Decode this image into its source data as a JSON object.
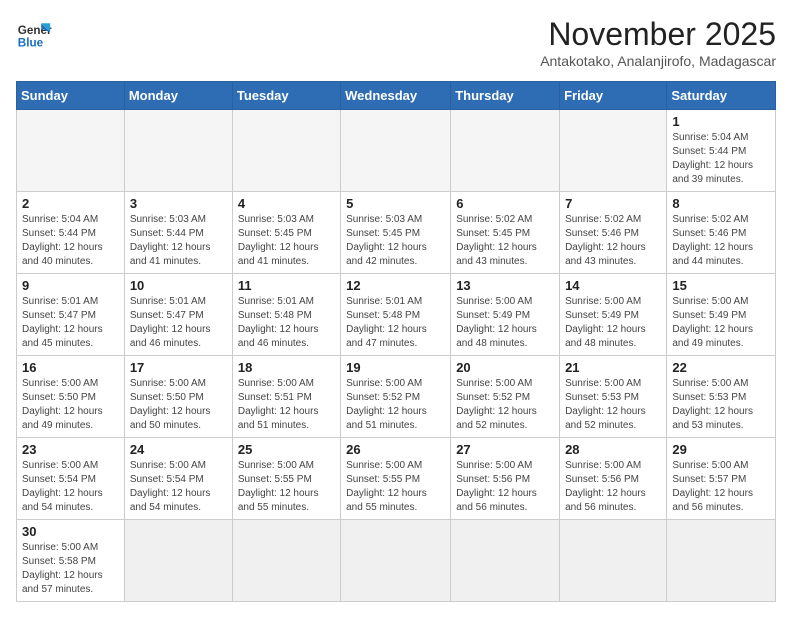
{
  "logo": {
    "text_general": "General",
    "text_blue": "Blue"
  },
  "title": "November 2025",
  "subtitle": "Antakotako, Analanjirofo, Madagascar",
  "days_header": [
    "Sunday",
    "Monday",
    "Tuesday",
    "Wednesday",
    "Thursday",
    "Friday",
    "Saturday"
  ],
  "weeks": [
    [
      {
        "day": "",
        "info": ""
      },
      {
        "day": "",
        "info": ""
      },
      {
        "day": "",
        "info": ""
      },
      {
        "day": "",
        "info": ""
      },
      {
        "day": "",
        "info": ""
      },
      {
        "day": "",
        "info": ""
      },
      {
        "day": "1",
        "info": "Sunrise: 5:04 AM\nSunset: 5:44 PM\nDaylight: 12 hours\nand 39 minutes."
      }
    ],
    [
      {
        "day": "2",
        "info": "Sunrise: 5:04 AM\nSunset: 5:44 PM\nDaylight: 12 hours\nand 40 minutes."
      },
      {
        "day": "3",
        "info": "Sunrise: 5:03 AM\nSunset: 5:44 PM\nDaylight: 12 hours\nand 41 minutes."
      },
      {
        "day": "4",
        "info": "Sunrise: 5:03 AM\nSunset: 5:45 PM\nDaylight: 12 hours\nand 41 minutes."
      },
      {
        "day": "5",
        "info": "Sunrise: 5:03 AM\nSunset: 5:45 PM\nDaylight: 12 hours\nand 42 minutes."
      },
      {
        "day": "6",
        "info": "Sunrise: 5:02 AM\nSunset: 5:45 PM\nDaylight: 12 hours\nand 43 minutes."
      },
      {
        "day": "7",
        "info": "Sunrise: 5:02 AM\nSunset: 5:46 PM\nDaylight: 12 hours\nand 43 minutes."
      },
      {
        "day": "8",
        "info": "Sunrise: 5:02 AM\nSunset: 5:46 PM\nDaylight: 12 hours\nand 44 minutes."
      }
    ],
    [
      {
        "day": "9",
        "info": "Sunrise: 5:01 AM\nSunset: 5:47 PM\nDaylight: 12 hours\nand 45 minutes."
      },
      {
        "day": "10",
        "info": "Sunrise: 5:01 AM\nSunset: 5:47 PM\nDaylight: 12 hours\nand 46 minutes."
      },
      {
        "day": "11",
        "info": "Sunrise: 5:01 AM\nSunset: 5:48 PM\nDaylight: 12 hours\nand 46 minutes."
      },
      {
        "day": "12",
        "info": "Sunrise: 5:01 AM\nSunset: 5:48 PM\nDaylight: 12 hours\nand 47 minutes."
      },
      {
        "day": "13",
        "info": "Sunrise: 5:00 AM\nSunset: 5:49 PM\nDaylight: 12 hours\nand 48 minutes."
      },
      {
        "day": "14",
        "info": "Sunrise: 5:00 AM\nSunset: 5:49 PM\nDaylight: 12 hours\nand 48 minutes."
      },
      {
        "day": "15",
        "info": "Sunrise: 5:00 AM\nSunset: 5:49 PM\nDaylight: 12 hours\nand 49 minutes."
      }
    ],
    [
      {
        "day": "16",
        "info": "Sunrise: 5:00 AM\nSunset: 5:50 PM\nDaylight: 12 hours\nand 49 minutes."
      },
      {
        "day": "17",
        "info": "Sunrise: 5:00 AM\nSunset: 5:50 PM\nDaylight: 12 hours\nand 50 minutes."
      },
      {
        "day": "18",
        "info": "Sunrise: 5:00 AM\nSunset: 5:51 PM\nDaylight: 12 hours\nand 51 minutes."
      },
      {
        "day": "19",
        "info": "Sunrise: 5:00 AM\nSunset: 5:52 PM\nDaylight: 12 hours\nand 51 minutes."
      },
      {
        "day": "20",
        "info": "Sunrise: 5:00 AM\nSunset: 5:52 PM\nDaylight: 12 hours\nand 52 minutes."
      },
      {
        "day": "21",
        "info": "Sunrise: 5:00 AM\nSunset: 5:53 PM\nDaylight: 12 hours\nand 52 minutes."
      },
      {
        "day": "22",
        "info": "Sunrise: 5:00 AM\nSunset: 5:53 PM\nDaylight: 12 hours\nand 53 minutes."
      }
    ],
    [
      {
        "day": "23",
        "info": "Sunrise: 5:00 AM\nSunset: 5:54 PM\nDaylight: 12 hours\nand 54 minutes."
      },
      {
        "day": "24",
        "info": "Sunrise: 5:00 AM\nSunset: 5:54 PM\nDaylight: 12 hours\nand 54 minutes."
      },
      {
        "day": "25",
        "info": "Sunrise: 5:00 AM\nSunset: 5:55 PM\nDaylight: 12 hours\nand 55 minutes."
      },
      {
        "day": "26",
        "info": "Sunrise: 5:00 AM\nSunset: 5:55 PM\nDaylight: 12 hours\nand 55 minutes."
      },
      {
        "day": "27",
        "info": "Sunrise: 5:00 AM\nSunset: 5:56 PM\nDaylight: 12 hours\nand 56 minutes."
      },
      {
        "day": "28",
        "info": "Sunrise: 5:00 AM\nSunset: 5:56 PM\nDaylight: 12 hours\nand 56 minutes."
      },
      {
        "day": "29",
        "info": "Sunrise: 5:00 AM\nSunset: 5:57 PM\nDaylight: 12 hours\nand 56 minutes."
      }
    ],
    [
      {
        "day": "30",
        "info": "Sunrise: 5:00 AM\nSunset: 5:58 PM\nDaylight: 12 hours\nand 57 minutes."
      },
      {
        "day": "",
        "info": ""
      },
      {
        "day": "",
        "info": ""
      },
      {
        "day": "",
        "info": ""
      },
      {
        "day": "",
        "info": ""
      },
      {
        "day": "",
        "info": ""
      },
      {
        "day": "",
        "info": ""
      }
    ]
  ]
}
